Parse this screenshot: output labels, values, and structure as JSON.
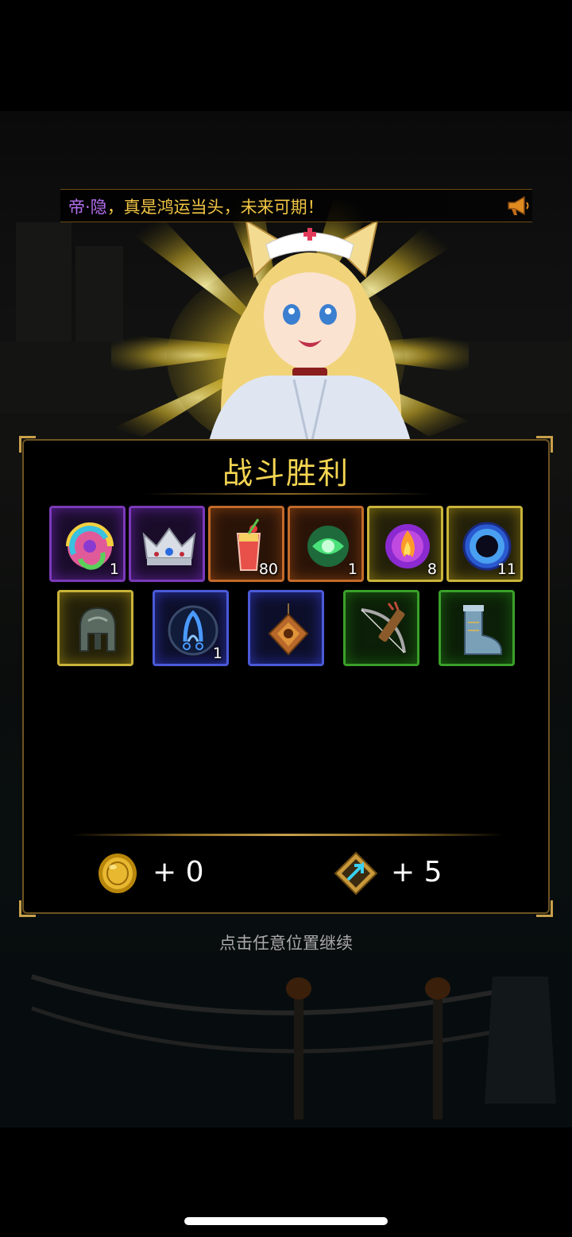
{
  "ticker": {
    "highlight": "帝·隐",
    "text": "，真是鸿运当头，未来可期！",
    "speaker_icon": "megaphone-icon"
  },
  "panel": {
    "title": "战斗胜利"
  },
  "items_row1": [
    {
      "icon": "rainbow-orb-icon",
      "rarity": "purple",
      "count": "1"
    },
    {
      "icon": "silver-crown-icon",
      "rarity": "purple",
      "count": ""
    },
    {
      "icon": "cocktail-drink-icon",
      "rarity": "orange",
      "count": "80"
    },
    {
      "icon": "green-swirl-orb-icon",
      "rarity": "orange",
      "count": "1"
    },
    {
      "icon": "fire-orb-icon",
      "rarity": "gold",
      "count": "8"
    },
    {
      "icon": "black-hole-orb-icon",
      "rarity": "gold",
      "count": "11"
    }
  ],
  "items_row2": [
    {
      "icon": "helmet-icon",
      "rarity": "gold",
      "count": ""
    },
    {
      "icon": "blue-rune-icon",
      "rarity": "blue",
      "count": "1"
    },
    {
      "icon": "amulet-icon",
      "rarity": "blue",
      "count": ""
    },
    {
      "icon": "bow-quiver-icon",
      "rarity": "green",
      "count": ""
    },
    {
      "icon": "boots-icon",
      "rarity": "green",
      "count": ""
    }
  ],
  "rewards": {
    "gold": {
      "icon": "gold-coin-icon",
      "value": "+ 0"
    },
    "exp": {
      "icon": "exp-crystal-icon",
      "value": "+ 5"
    }
  },
  "hint": "点击任意位置继续",
  "colors": {
    "title": "#f4d552",
    "ticker_text": "#f2c544",
    "ticker_highlight": "#b46ff0",
    "purple": "#7a3ab8",
    "orange": "#c26a2a",
    "gold": "#c9b33a",
    "blue": "#4a5ad8",
    "green": "#3aa02a"
  }
}
